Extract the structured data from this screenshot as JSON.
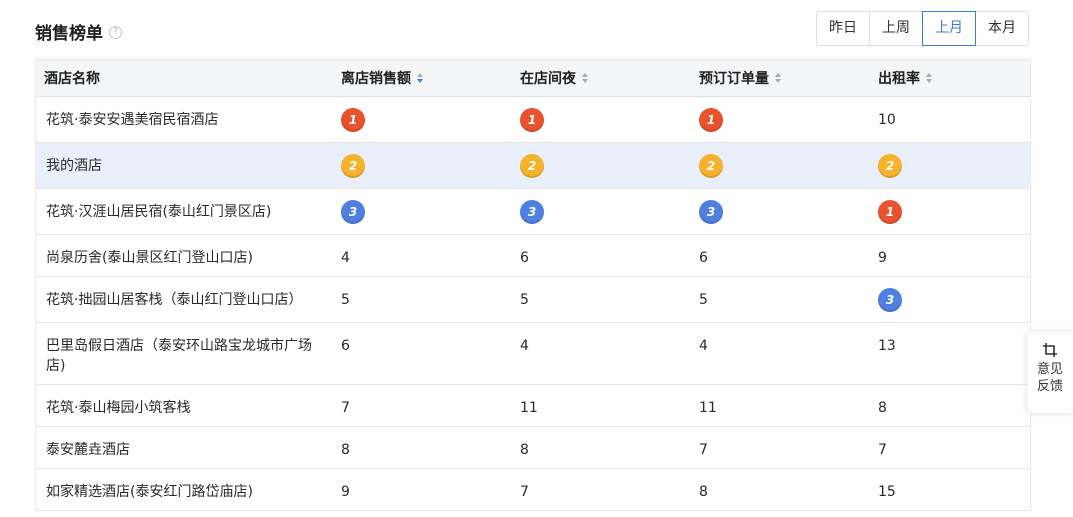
{
  "header": {
    "title": "销售榜单"
  },
  "period_tabs": [
    {
      "label": "昨日",
      "active": false
    },
    {
      "label": "上周",
      "active": false
    },
    {
      "label": "上月",
      "active": true
    },
    {
      "label": "本月",
      "active": false
    }
  ],
  "table": {
    "columns": [
      {
        "label": "酒店名称",
        "sortable": false
      },
      {
        "label": "离店销售额",
        "sortable": true,
        "sort": "desc"
      },
      {
        "label": "在店间夜",
        "sortable": true,
        "sort": "none"
      },
      {
        "label": "预订订单量",
        "sortable": true,
        "sort": "none"
      },
      {
        "label": "出租率",
        "sortable": true,
        "sort": "none"
      }
    ],
    "rows": [
      {
        "name": "花筑·泰安安遇美宿民宿酒店",
        "highlight": false,
        "values": [
          "1",
          "1",
          "1",
          "10"
        ]
      },
      {
        "name": "我的酒店",
        "highlight": true,
        "values": [
          "2",
          "2",
          "2",
          "2"
        ]
      },
      {
        "name": "花筑·汉涯山居民宿(泰山红门景区店)",
        "highlight": false,
        "values": [
          "3",
          "3",
          "3",
          "1"
        ]
      },
      {
        "name": "尚泉历舍(泰山景区红门登山口店)",
        "highlight": false,
        "values": [
          "4",
          "6",
          "6",
          "9"
        ]
      },
      {
        "name": "花筑·拙园山居客栈（泰山红门登山口店）",
        "highlight": false,
        "values": [
          "5",
          "5",
          "5",
          "3"
        ]
      },
      {
        "name": "巴里岛假日酒店（泰安环山路宝龙城市广场店)",
        "highlight": false,
        "values": [
          "6",
          "4",
          "4",
          "13"
        ]
      },
      {
        "name": "花筑·泰山梅园小筑客栈",
        "highlight": false,
        "values": [
          "7",
          "11",
          "11",
          "8"
        ]
      },
      {
        "name": "泰安麓垚酒店",
        "highlight": false,
        "values": [
          "8",
          "8",
          "7",
          "7"
        ]
      },
      {
        "name": "如家精选酒店(泰安红门路岱庙店)",
        "highlight": false,
        "values": [
          "9",
          "7",
          "8",
          "15"
        ]
      }
    ]
  },
  "medal_colors": {
    "1": "#e8522c",
    "2": "#f5b22a",
    "3": "#4f7fe0"
  },
  "feedback": {
    "line1": "意见",
    "line2": "反馈",
    "icon": "crop-icon"
  }
}
